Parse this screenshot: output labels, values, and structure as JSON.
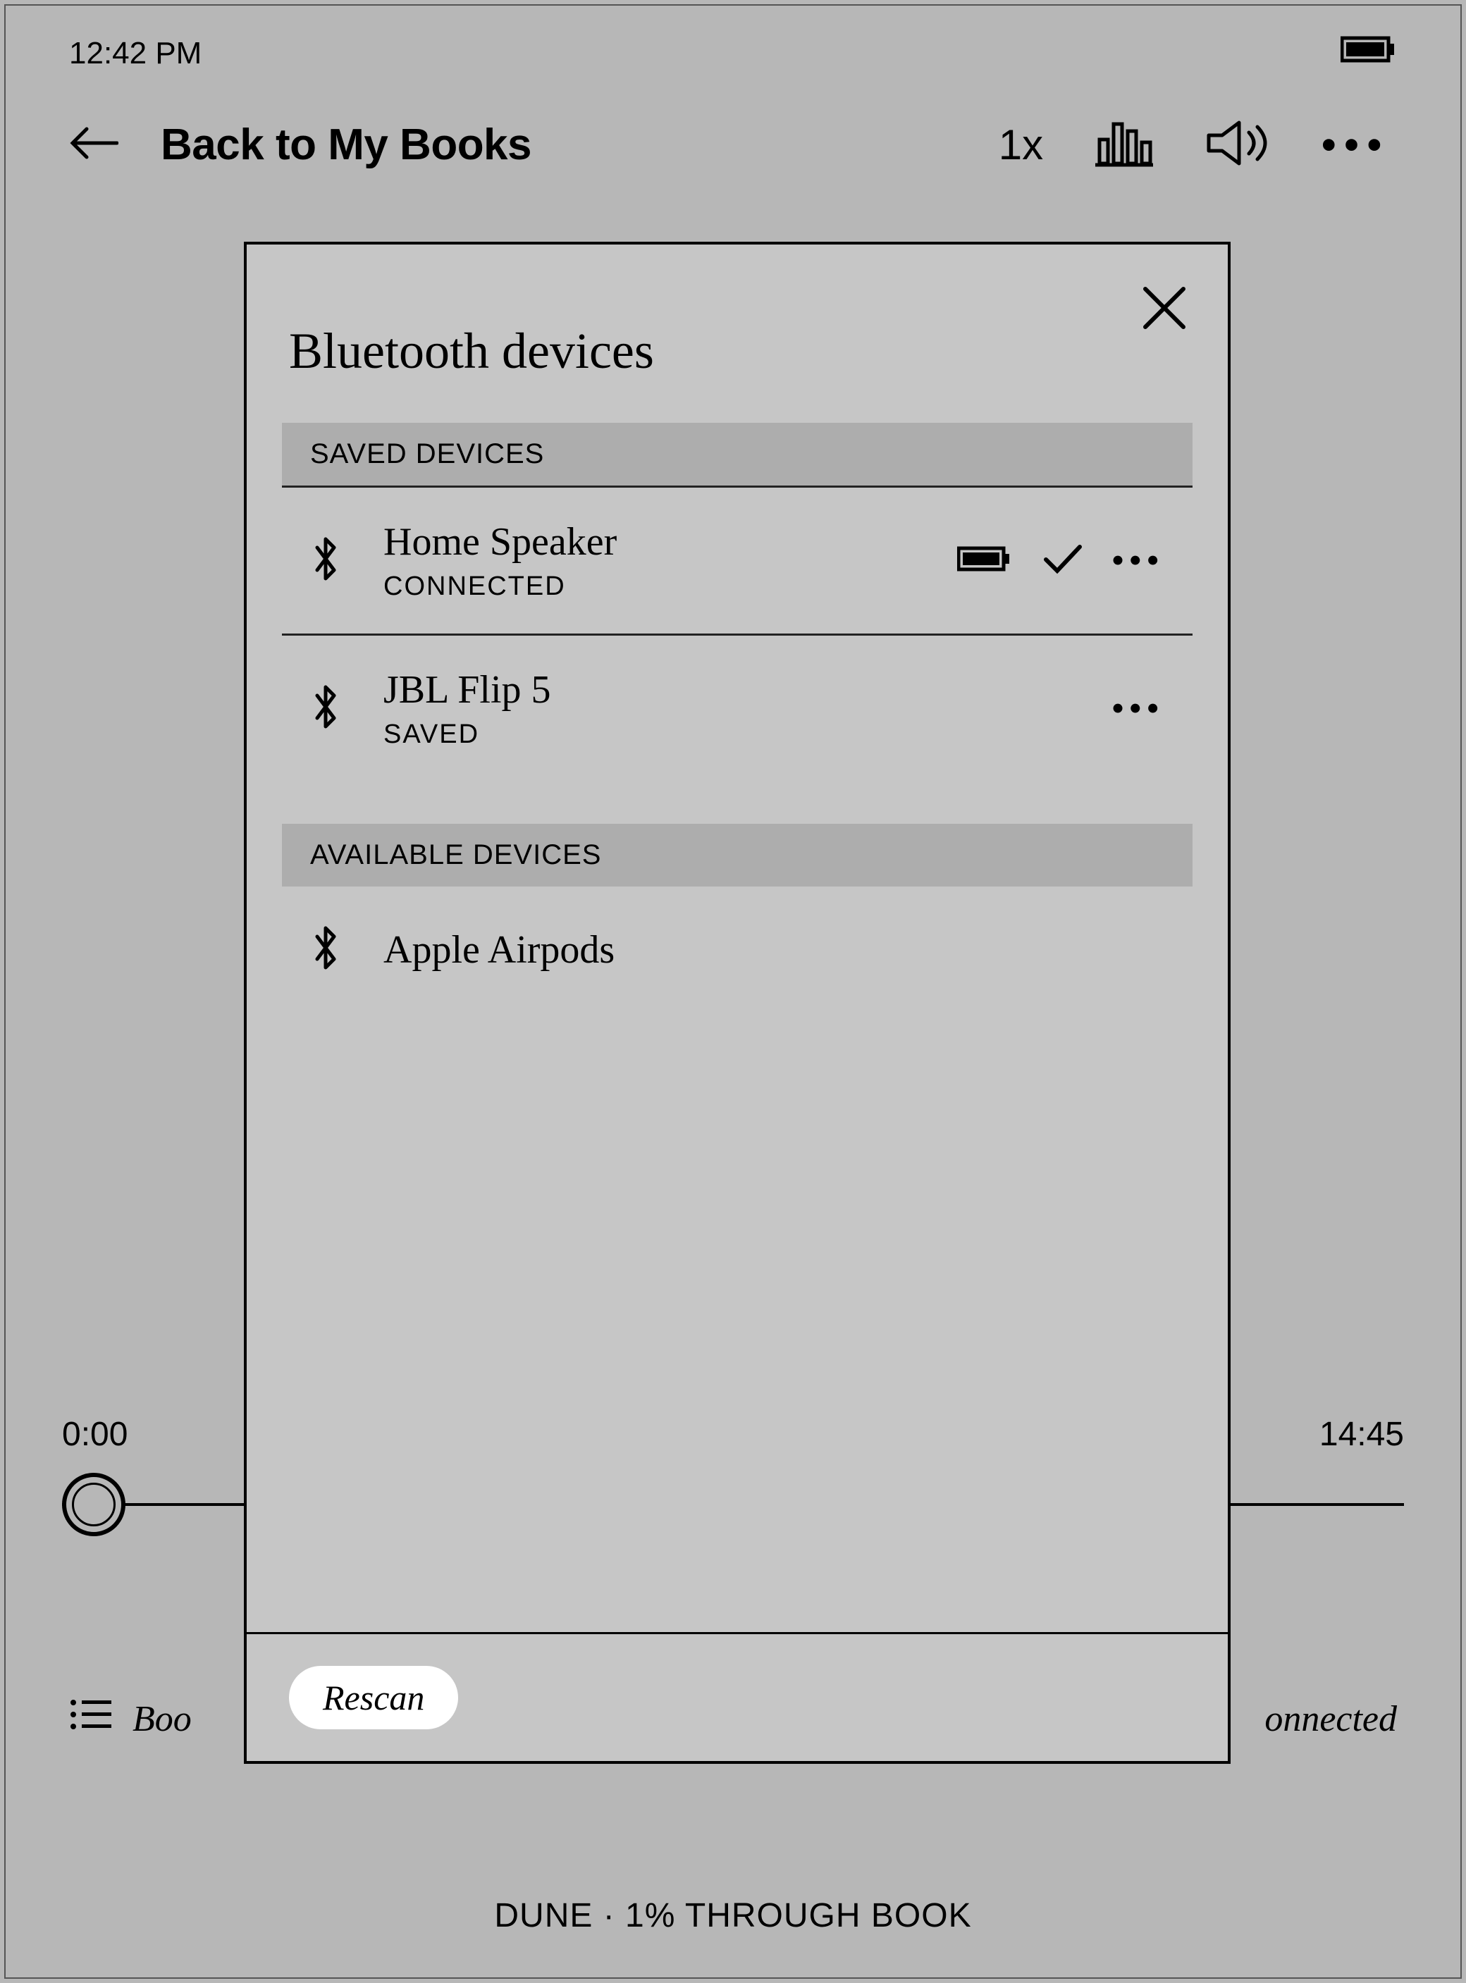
{
  "statusbar": {
    "time": "12:42 PM"
  },
  "header": {
    "back_label": "Back to My Books",
    "speed": "1x"
  },
  "player": {
    "elapsed": "0:00",
    "remaining": "14:45",
    "chapter_left_fragment": "Boo",
    "chapter_right_fragment": "onnected"
  },
  "footer": {
    "text": "DUNE · 1% THROUGH BOOK"
  },
  "modal": {
    "title": "Bluetooth devices",
    "saved_header": "SAVED DEVICES",
    "available_header": "AVAILABLE DEVICES",
    "rescan_label": "Rescan",
    "saved_devices": [
      {
        "name": "Home Speaker",
        "status": "CONNECTED",
        "has_battery": true,
        "has_check": true
      },
      {
        "name": "JBL Flip 5",
        "status": "SAVED",
        "has_battery": false,
        "has_check": false
      }
    ],
    "available_devices": [
      {
        "name": "Apple Airpods"
      }
    ]
  }
}
